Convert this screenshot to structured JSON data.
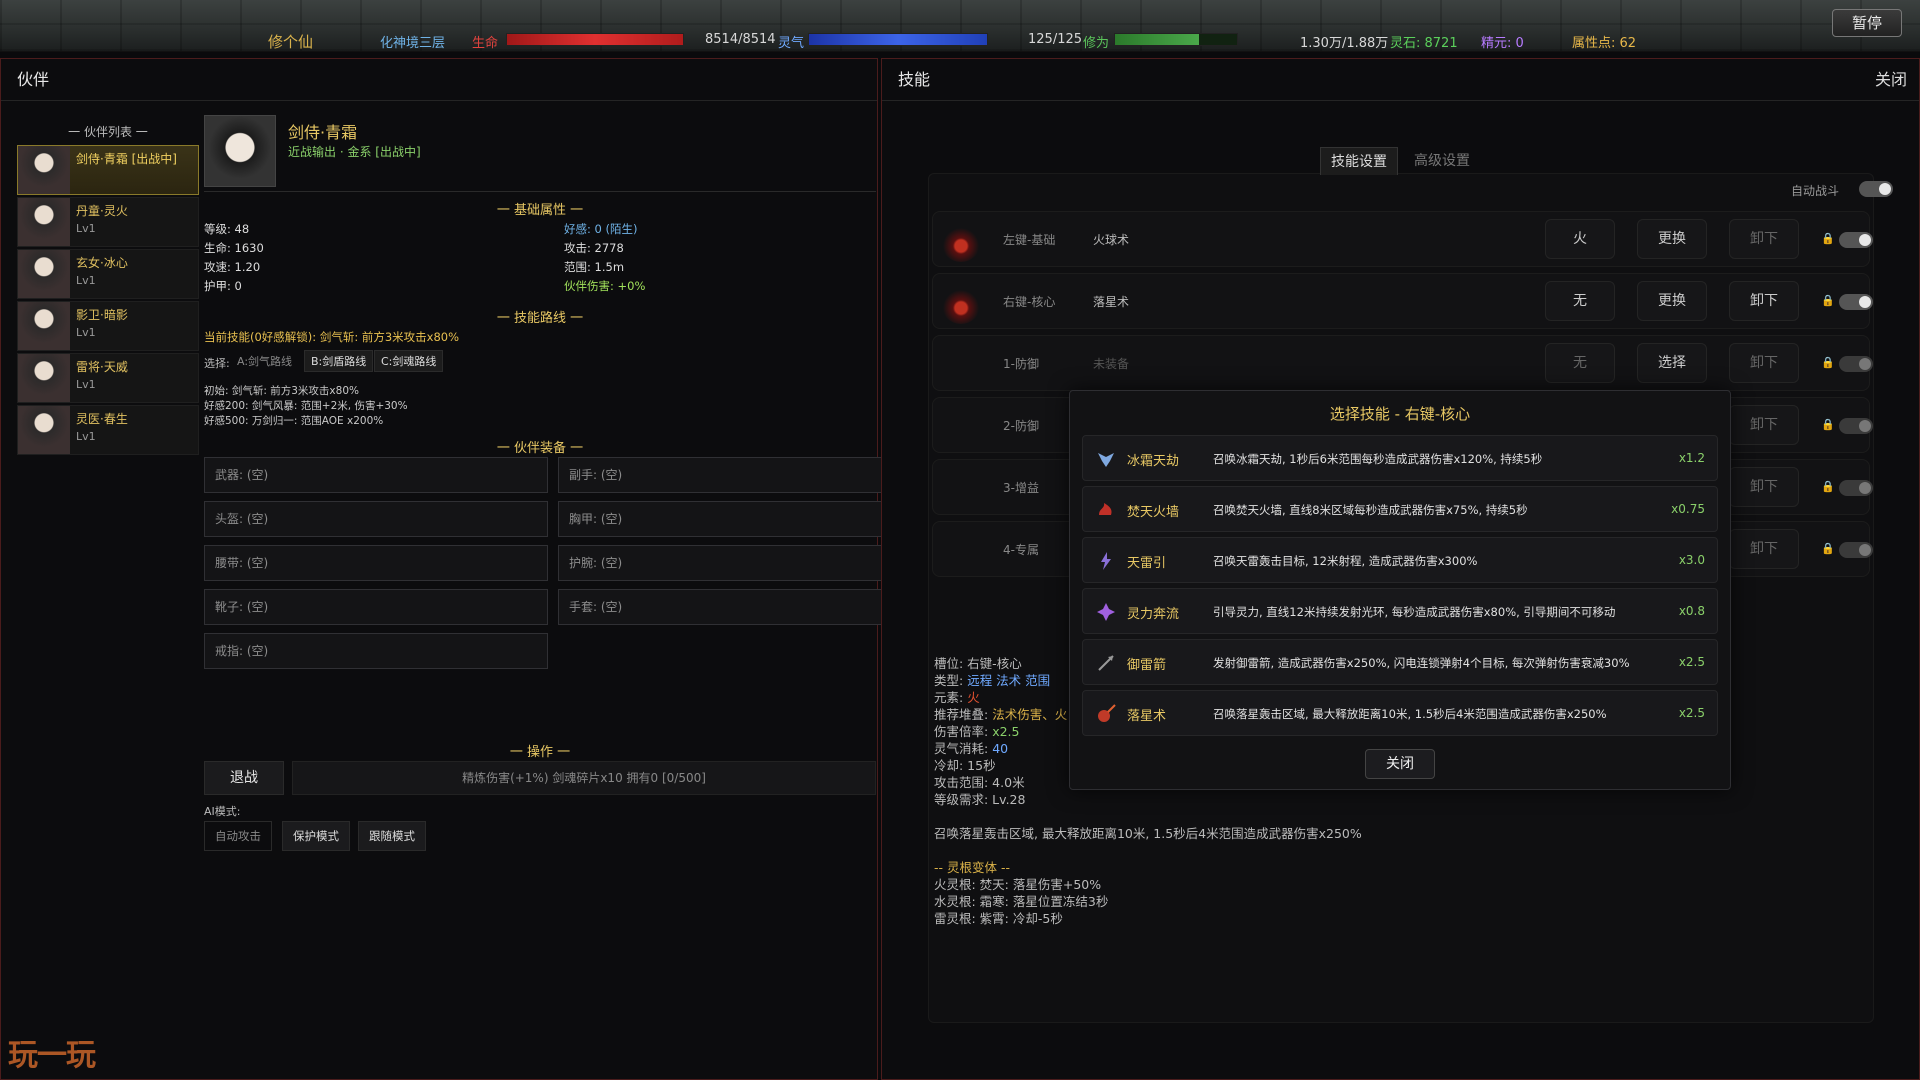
{
  "topbar": {
    "title": "修个仙",
    "realm": "化神境三层",
    "hp_label": "生命",
    "hp_value": "8514/8514",
    "hp_fraction": 1.0,
    "mp_label": "灵气",
    "mp_value": "125/125",
    "mp_fraction": 1.0,
    "cultivation_label": "修为",
    "cultivation_value": "1.30万/1.88万",
    "cultivation_fraction": 0.69,
    "spirit_stone": "灵石: 8721",
    "elite": "精元: 0",
    "attr_points": "属性点: 62",
    "pause_label": "暂停"
  },
  "partner_panel": {
    "title": "伙伴",
    "list_title": "一 伙伴列表 一",
    "partners": [
      {
        "name": "剑侍·青霜 [出战中]",
        "level": "",
        "active": true
      },
      {
        "name": "丹童·灵火",
        "level": "Lv1"
      },
      {
        "name": "玄女·冰心",
        "level": "Lv1"
      },
      {
        "name": "影卫·暗影",
        "level": "Lv1"
      },
      {
        "name": "雷将·天威",
        "level": "Lv1"
      },
      {
        "name": "灵医·春生",
        "level": "Lv1"
      }
    ],
    "detail": {
      "name": "剑侍·青霜",
      "subtitle": "近战输出 · 金系 [出战中]",
      "basic_title": "一 基础属性 一",
      "stats_left": [
        "等级: 48",
        "生命: 1630",
        "攻速: 1.20",
        "护甲: 0"
      ],
      "stats_right": [
        "好感: 0 (陌生)",
        "攻击: 2778",
        "范围: 1.5m",
        "伙伴伤害: +0%"
      ],
      "route_title": "一 技能路线 一",
      "current_skill": "当前技能(0好感解锁): 剑气斩: 前方3米攻击x80%",
      "select_label": "选择:",
      "routes": [
        "A:剑气路线",
        "B:剑盾路线",
        "C:剑魂路线"
      ],
      "route_notes": [
        "初始: 剑气斩: 前方3米攻击x80%",
        "好感200: 剑气风暴: 范围+2米, 伤害+30%",
        "好感500: 万剑归一: 范围AOE x200%"
      ],
      "equip_title": "一 伙伴装备 一",
      "equipment": [
        "武器: (空)",
        "副手: (空)",
        "头盔: (空)",
        "胸甲: (空)",
        "腰带: (空)",
        "护腕: (空)",
        "靴子: (空)",
        "手套: (空)",
        "戒指: (空)"
      ],
      "ops_title": "一 操作 一",
      "retire_label": "退战",
      "refine_text": "精炼伤害(+1%) 剑魂碎片x10 拥有0 [0/500]",
      "ai_label": "AI模式:",
      "ai_modes": [
        "自动攻击",
        "保护模式",
        "跟随模式"
      ]
    }
  },
  "skill_panel": {
    "title": "技能",
    "close_label": "关闭",
    "tabs": [
      "技能设置",
      "高级设置"
    ],
    "auto_battle_label": "自动战斗",
    "slots": [
      {
        "key": "左键-基础",
        "skill": "火球术",
        "element": "火",
        "replace": "更换",
        "unequip": "卸下",
        "lock": "🔒"
      },
      {
        "key": "右键-核心",
        "skill": "落星术",
        "element": "无",
        "replace": "更换",
        "unequip": "卸下",
        "lock": "🔒"
      },
      {
        "key": "1-防御",
        "skill": "未装备",
        "element": "无",
        "replace": "选择",
        "unequip": "卸下",
        "lock": "🔒"
      },
      {
        "key": "2-防御",
        "skill": "",
        "element": "",
        "replace": "",
        "unequip": "卸下",
        "lock": "🔒"
      },
      {
        "key": "3-增益",
        "skill": "",
        "element": "",
        "replace": "",
        "unequip": "卸下",
        "lock": "🔒"
      },
      {
        "key": "4-专属",
        "skill": "",
        "element": "",
        "replace": "",
        "unequip": "卸下",
        "lock": "🔒"
      }
    ],
    "info": {
      "slot": "槽位: 右键-核心",
      "type_label": "类型:",
      "type_value": "远程 法术 范围",
      "element_label": "元素:",
      "element_value": "火",
      "recommend_label": "推荐堆叠:",
      "recommend_value": "法术伤害、火",
      "multiplier_label": "伤害倍率:",
      "multiplier_value": "x2.5",
      "cost_label": "灵气消耗:",
      "cost_value": "40",
      "cooldown": "冷却: 15秒",
      "range": "攻击范围: 4.0米",
      "level_req": "等级需求: Lv.28",
      "description": "召唤落星轰击区域, 最大释放距离10米, 1.5秒后4米范围造成武器伤害x250%",
      "variant_title": "-- 灵根变体 --",
      "variants": [
        "火灵根: 焚天: 落星伤害+50%",
        "水灵根: 霜寒: 落星位置冻结3秒",
        "雷灵根: 紫霄: 冷却-5秒"
      ]
    },
    "modal": {
      "title": "选择技能 - 右键-核心",
      "options": [
        {
          "name": "冰霜天劫",
          "desc": "召唤冰霜天劫, 1秒后6米范围每秒造成武器伤害x120%, 持续5秒",
          "mult": "x1.2",
          "icon": "ice-icon",
          "color": "#7fa8e0"
        },
        {
          "name": "焚天火墙",
          "desc": "召唤焚天火墙, 直线8米区域每秒造成武器伤害x75%, 持续5秒",
          "mult": "x0.75",
          "icon": "fire-wall-icon",
          "color": "#c03028"
        },
        {
          "name": "天雷引",
          "desc": "召唤天雷轰击目标, 12米射程, 造成武器伤害x300%",
          "mult": "x3.0",
          "icon": "thunder-icon",
          "color": "#8a70d8"
        },
        {
          "name": "灵力奔流",
          "desc": "引导灵力, 直线12米持续发射光环, 每秒造成武器伤害x80%, 引导期间不可移动",
          "mult": "x0.8",
          "icon": "spirit-flow-icon",
          "color": "#a060e0"
        },
        {
          "name": "御雷箭",
          "desc": "发射御雷箭, 造成武器伤害x250%, 闪电连锁弹射4个目标, 每次弹射伤害衰减30%",
          "mult": "x2.5",
          "icon": "thunder-arrow-icon",
          "color": "#999999"
        },
        {
          "name": "落星术",
          "desc": "召唤落星轰击区域, 最大释放距离10米, 1.5秒后4米范围造成武器伤害x250%",
          "mult": "x2.5",
          "icon": "meteor-icon",
          "color": "#c03a28"
        }
      ],
      "close_label": "关闭"
    }
  },
  "watermark": "玩一玩"
}
